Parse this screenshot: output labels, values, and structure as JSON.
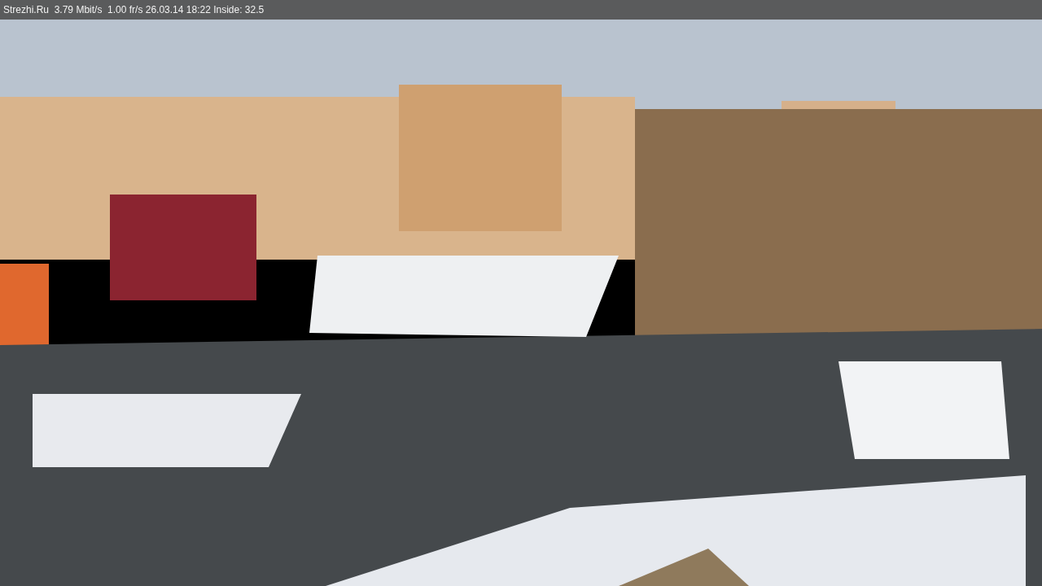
{
  "overlay_bar": {
    "text": "Strezhi.Ru  3.79 Mbit/s  1.00 fr/s 26.03.14 18:22 Inside: 32.5"
  }
}
